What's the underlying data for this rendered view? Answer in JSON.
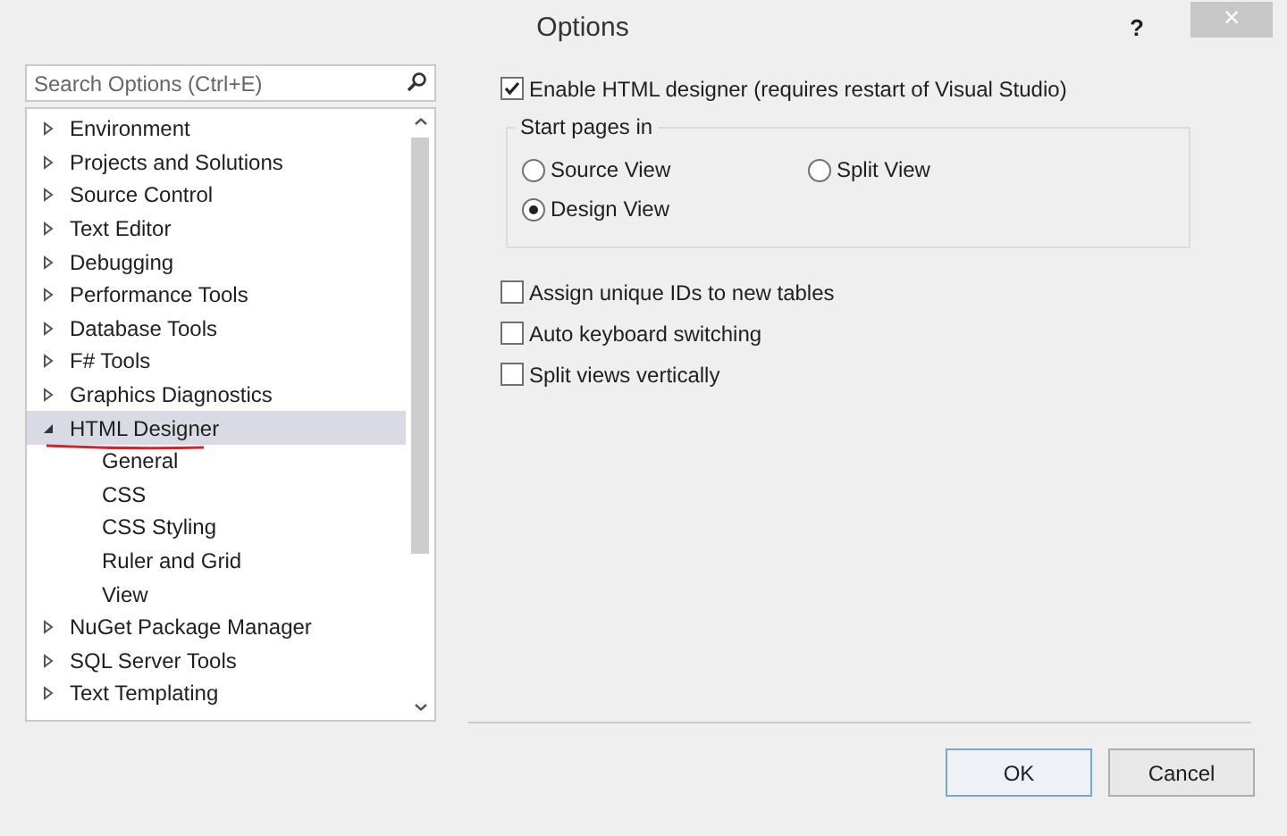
{
  "window": {
    "title": "Options",
    "help": "?",
    "close": "×"
  },
  "search": {
    "placeholder": "Search Options (Ctrl+E)"
  },
  "tree": [
    {
      "label": "Environment",
      "expanded": false,
      "selected": false
    },
    {
      "label": "Projects and Solutions",
      "expanded": false,
      "selected": false
    },
    {
      "label": "Source Control",
      "expanded": false,
      "selected": false
    },
    {
      "label": "Text Editor",
      "expanded": false,
      "selected": false
    },
    {
      "label": "Debugging",
      "expanded": false,
      "selected": false
    },
    {
      "label": "Performance Tools",
      "expanded": false,
      "selected": false
    },
    {
      "label": "Database Tools",
      "expanded": false,
      "selected": false
    },
    {
      "label": "F# Tools",
      "expanded": false,
      "selected": false
    },
    {
      "label": "Graphics Diagnostics",
      "expanded": false,
      "selected": false
    },
    {
      "label": "HTML Designer",
      "expanded": true,
      "selected": true,
      "underlined": true,
      "children": [
        {
          "label": "General",
          "selected": false
        },
        {
          "label": "CSS",
          "selected": false
        },
        {
          "label": "CSS Styling",
          "selected": false
        },
        {
          "label": "Ruler and Grid",
          "selected": false
        },
        {
          "label": "View",
          "selected": false
        }
      ]
    },
    {
      "label": "NuGet Package Manager",
      "expanded": false,
      "selected": false
    },
    {
      "label": "SQL Server Tools",
      "expanded": false,
      "selected": false
    },
    {
      "label": "Text Templating",
      "expanded": false,
      "selected": false
    }
  ],
  "enable_designer": {
    "label": "Enable HTML designer (requires restart of Visual Studio)",
    "checked": true
  },
  "start_pages": {
    "title": "Start pages in",
    "options": [
      {
        "label": "Source View",
        "selected": false
      },
      {
        "label": "Split View",
        "selected": false
      },
      {
        "label": "Design View",
        "selected": true
      }
    ]
  },
  "options": [
    {
      "label": "Assign unique IDs to new tables",
      "checked": false
    },
    {
      "label": "Auto keyboard switching",
      "checked": false
    },
    {
      "label": "Split views vertically",
      "checked": false
    }
  ],
  "buttons": [
    {
      "label": "OK",
      "default": true
    },
    {
      "label": "Cancel",
      "default": false
    }
  ]
}
